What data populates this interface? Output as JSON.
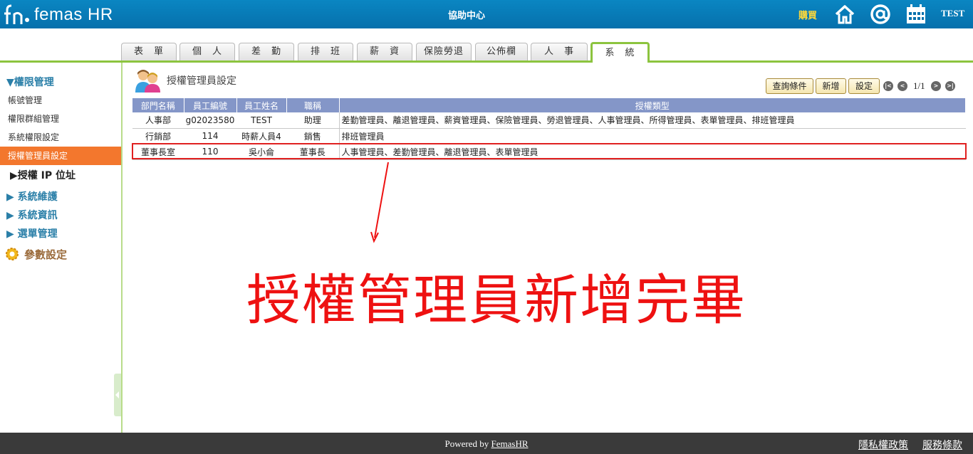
{
  "header": {
    "logo_text": "femas HR",
    "title": "協助中心",
    "buy_label": "購買",
    "user": "TEST",
    "icons": [
      "home-icon",
      "at-icon",
      "calendar-icon"
    ]
  },
  "tabs": [
    "表　單",
    "個　人",
    "差　勤",
    "排　班",
    "薪　資",
    "保險勞退",
    "公佈欄",
    "人　事",
    "系　統"
  ],
  "active_tab": "系　統",
  "sidebar": {
    "group_permission": "▼權限管理",
    "items": [
      "帳號管理",
      "權限群組管理",
      "系統權限設定",
      "授權管理員設定"
    ],
    "active_item": "授權管理員設定",
    "sub_ip": "▶授權 IP 位址",
    "group_maintain": "▶ 系統維護",
    "group_info": "▶ 系統資訊",
    "group_menu": "▶ 選單管理",
    "params": "參數設定"
  },
  "main": {
    "page_title": "授權管理員設定",
    "buttons": {
      "query": "查詢條件",
      "add": "新增",
      "settings": "設定"
    },
    "pager": {
      "first": "|<",
      "prev": "<",
      "text": "1/1",
      "next": ">",
      "last": ">|"
    },
    "columns": [
      "部門名稱",
      "員工編號",
      "員工姓名",
      "職稱",
      "授權類型"
    ],
    "rows": [
      [
        "人事部",
        "g02023580",
        "TEST",
        "助理",
        "差勤管理員、離退管理員、薪資管理員、保險管理員、勞退管理員、人事管理員、所得管理員、表單管理員、排班管理員"
      ],
      [
        "行銷部",
        "114",
        "時薪人員4",
        "銷售",
        "排班管理員"
      ],
      [
        "董事長室",
        "110",
        "吳小侖",
        "董事長",
        "人事管理員、差勤管理員、離退管理員、表單管理員"
      ]
    ]
  },
  "annotation": "授權管理員新增完畢",
  "footer": {
    "powered_prefix": "Powered by ",
    "powered_link": "FemasHR",
    "privacy": "隱私權政策",
    "terms": "服務條款"
  },
  "colors": {
    "header": "#0a86c2",
    "accent_green": "#8cc43f",
    "sidebar_active": "#f3772d",
    "table_header": "#8496c8",
    "annotation": "#ee1111"
  }
}
